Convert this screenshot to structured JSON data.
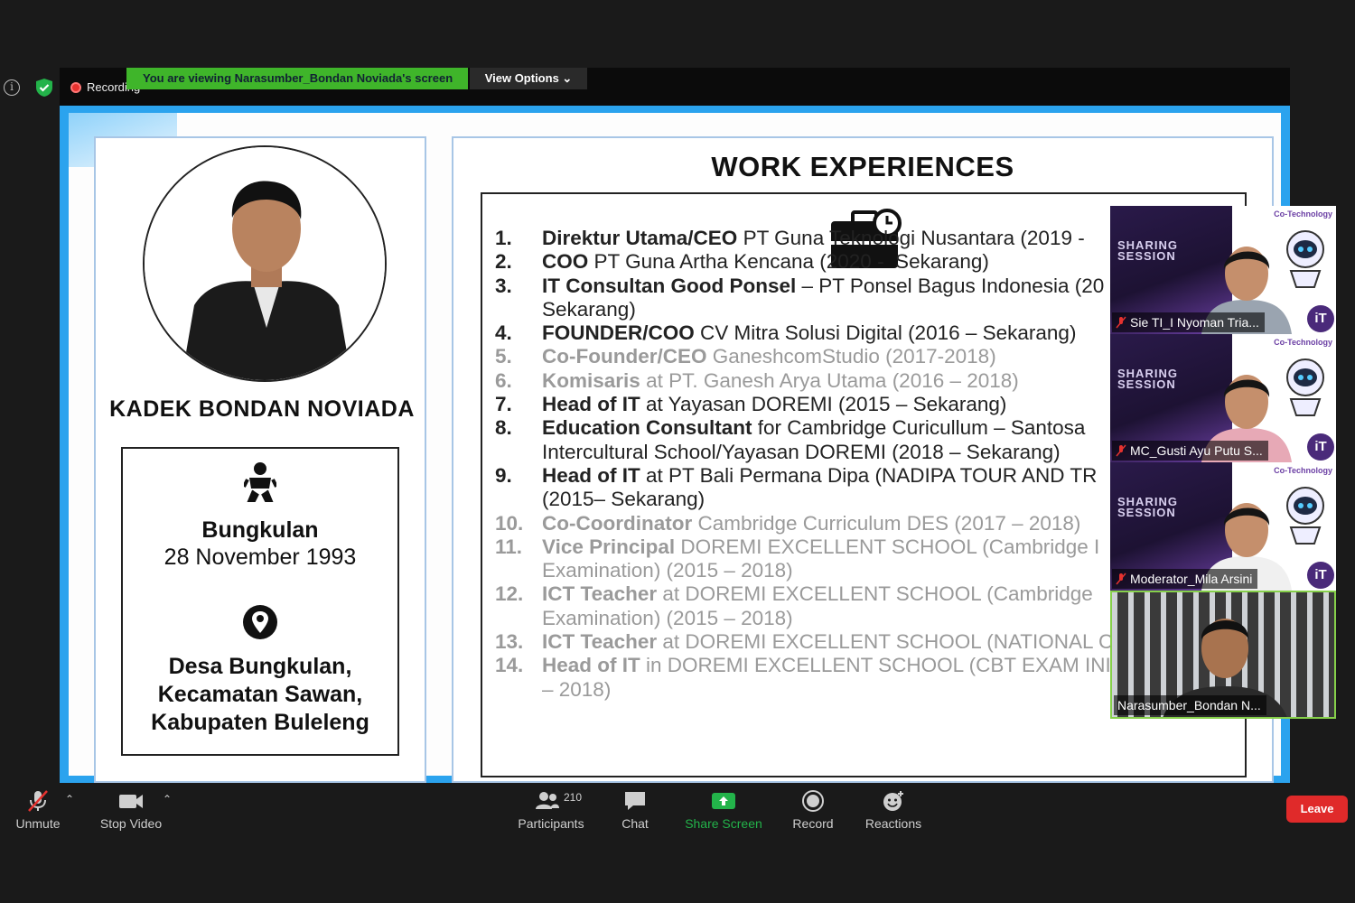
{
  "topbar": {
    "recording_label": "Recording",
    "viewing_banner": "You are viewing Narasumber_Bondan Noviada's screen",
    "view_options": "View Options ⌄"
  },
  "slide": {
    "speaker_name": "KADEK BONDAN NOVIADA",
    "birth_place": "Bungkulan",
    "birth_date": "28 November 1993",
    "address": "Desa Bungkulan,\nKecamatan Sawan,\nKabupaten Buleleng",
    "work_title": "WORK EXPERIENCES",
    "experiences": [
      {
        "num": "1.",
        "bold": "Direktur Utama/CEO",
        "rest": " PT Guna Teknologi Nusantara (2019 -",
        "faded": false
      },
      {
        "num": "2.",
        "bold": "COO",
        "rest": " PT Guna Artha Kencana (2020 -  Sekarang)",
        "faded": false
      },
      {
        "num": "3.",
        "bold": "IT Consultan Good Ponsel",
        "rest": " – PT Ponsel Bagus Indonesia (20\nSekarang)",
        "faded": false
      },
      {
        "num": "4.",
        "bold": "FOUNDER/COO",
        "rest": " CV Mitra Solusi Digital (2016 – Sekarang)",
        "faded": false
      },
      {
        "num": "5.",
        "bold": "Co-Founder/CEO",
        "rest": " GaneshcomStudio (2017-2018)",
        "faded": true
      },
      {
        "num": "6.",
        "bold": "Komisaris",
        "rest": " at PT. Ganesh Arya Utama (2016 – 2018)",
        "faded": true
      },
      {
        "num": "7.",
        "bold": "Head of IT",
        "rest": " at Yayasan DOREMI (2015 – Sekarang)",
        "faded": false
      },
      {
        "num": "8.",
        "bold": "Education Consultant",
        "rest": " for Cambridge Curicullum – Santosa\nIntercultural School/Yayasan DOREMI (2018 – Sekarang)",
        "faded": false
      },
      {
        "num": "9.",
        "bold": "Head of IT",
        "rest": " at PT Bali Permana Dipa (NADIPA TOUR AND TR\n(2015– Sekarang)",
        "faded": false
      },
      {
        "num": "10.",
        "bold": "Co-Coordinator",
        "rest": " Cambridge Curriculum DES (2017 – 2018)",
        "faded": true
      },
      {
        "num": "11.",
        "bold": "Vice Principal",
        "rest": " DOREMI EXCELLENT SCHOOL (Cambridge I\nExamination) (2015 – 2018)",
        "faded": true
      },
      {
        "num": "12.",
        "bold": "ICT Teacher",
        "rest": " at DOREMI EXCELLENT SCHOOL (Cambridge\nExamination) (2015 – 2018)",
        "faded": true
      },
      {
        "num": "13.",
        "bold": "ICT Teacher",
        "rest": " at DOREMI EXCELLENT SCHOOL (NATIONAL C",
        "faded": true
      },
      {
        "num": "14.",
        "bold": "Head of IT",
        "rest": " in DOREMI EXCELLENT SCHOOL (CBT EXAM INIS\n– 2018)",
        "faded": true
      }
    ]
  },
  "participants_panel": {
    "tiles": [
      {
        "name": "Sie TI_I Nyoman Tria...",
        "muted": true,
        "banner": "SHARING\nSESSION",
        "cotech": "Co-Technology",
        "badge": "iT"
      },
      {
        "name": "MC_Gusti Ayu Putu S...",
        "muted": true,
        "banner": "SHARING\nSESSION",
        "cotech": "Co-Technology",
        "badge": "iT"
      },
      {
        "name": "Moderator_Mila Arsini",
        "muted": true,
        "banner": "SHARING\nSESSION",
        "cotech": "Co-Technology",
        "badge": "iT"
      },
      {
        "name": "Narasumber_Bondan N...",
        "muted": false
      }
    ]
  },
  "toolbar": {
    "unmute": "Unmute",
    "stop_video": "Stop Video",
    "participants": "Participants",
    "participants_count": "210",
    "chat": "Chat",
    "share_screen": "Share Screen",
    "record": "Record",
    "reactions": "Reactions",
    "leave": "Leave"
  },
  "colors": {
    "banner_green": "#3fb52a",
    "slide_blue": "#2ba3ee",
    "share_green": "#23b34a",
    "leave_red": "#e02a2a"
  }
}
